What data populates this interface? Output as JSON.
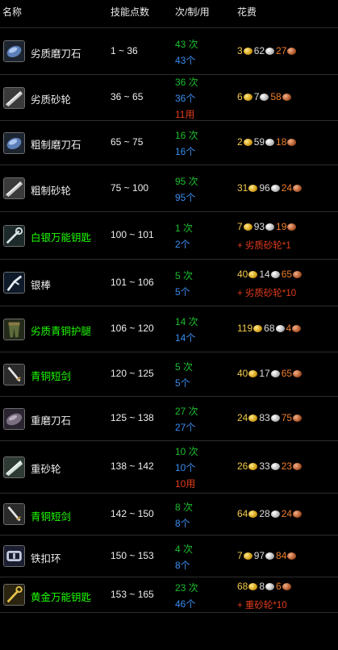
{
  "header": {
    "name": "名称",
    "skill": "技能点数",
    "per": "次/制/用",
    "cost": "花费"
  },
  "rows": [
    {
      "icon": "whetstone-icon",
      "name": "劣质磨刀石",
      "green": false,
      "range": "1 ~ 36",
      "c1": "43 次",
      "c2": "43个",
      "c3": "",
      "g": "3",
      "s": "62",
      "c": "27",
      "extra": ""
    },
    {
      "icon": "grinding-stone-icon",
      "name": "劣质砂轮",
      "green": false,
      "range": "36 ~ 65",
      "c1": "36 次",
      "c2": "36个",
      "c3": "11用",
      "g": "6",
      "s": "7",
      "c": "58",
      "extra": ""
    },
    {
      "icon": "whetstone-icon",
      "name": "粗制磨刀石",
      "green": false,
      "range": "65 ~ 75",
      "c1": "16 次",
      "c2": "16个",
      "c3": "",
      "g": "2",
      "s": "59",
      "c": "18",
      "extra": ""
    },
    {
      "icon": "grinding-stone-icon",
      "name": "粗制砂轮",
      "green": false,
      "range": "75 ~ 100",
      "c1": "95 次",
      "c2": "95个",
      "c3": "",
      "g": "31",
      "s": "96",
      "c": "24",
      "extra": ""
    },
    {
      "icon": "skeleton-key-icon",
      "name": "白银万能钥匙",
      "green": true,
      "range": "100 ~ 101",
      "c1": "1 次",
      "c2": "2个",
      "c3": "",
      "g": "7",
      "s": "93",
      "c": "19",
      "extra": "+ 劣质砂轮*1"
    },
    {
      "icon": "silver-rod-icon",
      "name": "银棒",
      "green": false,
      "range": "101 ~ 106",
      "c1": "5 次",
      "c2": "5个",
      "c3": "",
      "g": "40",
      "s": "14",
      "c": "65",
      "extra": "+ 劣质砂轮*10"
    },
    {
      "icon": "leggings-icon",
      "name": "劣质青铜护腿",
      "green": true,
      "range": "106 ~ 120",
      "c1": "14 次",
      "c2": "14个",
      "c3": "",
      "g": "119",
      "s": "68",
      "c": "4",
      "extra": ""
    },
    {
      "icon": "shortsword-icon",
      "name": "青铜短剑",
      "green": true,
      "range": "120 ~ 125",
      "c1": "5 次",
      "c2": "5个",
      "c3": "",
      "g": "40",
      "s": "17",
      "c": "65",
      "extra": ""
    },
    {
      "icon": "heavy-whetstone-icon",
      "name": "重磨刀石",
      "green": false,
      "range": "125 ~ 138",
      "c1": "27 次",
      "c2": "27个",
      "c3": "",
      "g": "24",
      "s": "83",
      "c": "75",
      "extra": ""
    },
    {
      "icon": "heavy-grinding-stone-icon",
      "name": "重砂轮",
      "green": false,
      "range": "138 ~ 142",
      "c1": "10 次",
      "c2": "10个",
      "c3": "10用",
      "g": "26",
      "s": "33",
      "c": "23",
      "extra": ""
    },
    {
      "icon": "shortsword-icon",
      "name": "青铜短剑",
      "green": true,
      "range": "142 ~ 150",
      "c1": "8 次",
      "c2": "8个",
      "c3": "",
      "g": "64",
      "s": "28",
      "c": "24",
      "extra": ""
    },
    {
      "icon": "iron-buckle-icon",
      "name": "铁扣环",
      "green": false,
      "range": "150 ~ 153",
      "c1": "4 次",
      "c2": "8个",
      "c3": "",
      "g": "7",
      "s": "97",
      "c": "84",
      "extra": ""
    },
    {
      "icon": "golden-key-icon",
      "name": "黄金万能钥匙",
      "green": true,
      "range": "153 ~ 165",
      "c1": "23 次",
      "c2": "46个",
      "c3": "",
      "g": "68",
      "s": "8",
      "c": "6",
      "extra": "+ 重砂轮*10"
    }
  ]
}
